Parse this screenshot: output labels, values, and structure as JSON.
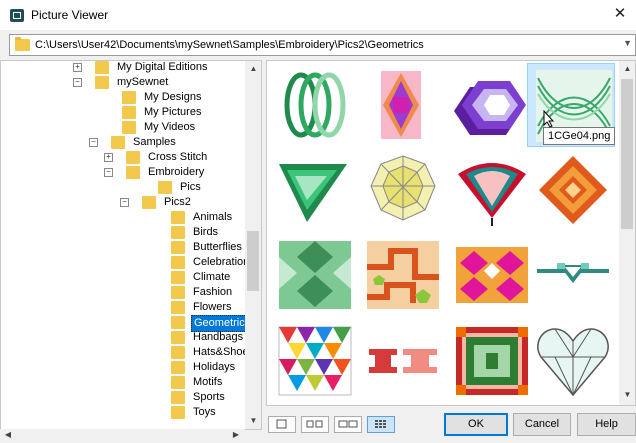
{
  "window": {
    "title": "Picture Viewer",
    "close_glyph": "✕"
  },
  "path": {
    "value": "C:\\Users\\User42\\Documents\\mySewnet\\Samples\\Embroidery\\Pics2\\Geometrics"
  },
  "tree": {
    "items": [
      {
        "label": "My Digital Editions",
        "expander": "+"
      },
      {
        "label": "mySewnet",
        "expander": "−"
      },
      {
        "label": "My Designs"
      },
      {
        "label": "My Pictures"
      },
      {
        "label": "My Videos"
      },
      {
        "label": "Samples",
        "expander": "−"
      },
      {
        "label": "Cross Stitch",
        "expander": "+"
      },
      {
        "label": "Embroidery",
        "expander": "−"
      },
      {
        "label": "Pics"
      },
      {
        "label": "Pics2",
        "expander": "−"
      },
      {
        "label": "Animals"
      },
      {
        "label": "Birds"
      },
      {
        "label": "Butterflies"
      },
      {
        "label": "Celebration"
      },
      {
        "label": "Climate"
      },
      {
        "label": "Fashion"
      },
      {
        "label": "Flowers"
      },
      {
        "label": "Geometrics",
        "selected": true
      },
      {
        "label": "Handbags"
      },
      {
        "label": "Hats&Shoes"
      },
      {
        "label": "Holidays"
      },
      {
        "label": "Motifs"
      },
      {
        "label": "Sports"
      },
      {
        "label": "Toys"
      }
    ]
  },
  "thumbnails": [
    {
      "icon": "green-rings-icon"
    },
    {
      "icon": "pink-diamond-rectangle-icon"
    },
    {
      "icon": "purple-hexagons-icon"
    },
    {
      "icon": "green-arcs-icon",
      "hovered": true
    },
    {
      "icon": "green-chevron-icon"
    },
    {
      "icon": "yellow-octagon-icon"
    },
    {
      "icon": "red-fan-icon"
    },
    {
      "icon": "orange-diamond-maze-icon"
    },
    {
      "icon": "green-cube-pattern-icon"
    },
    {
      "icon": "orange-zigzag-square-icon"
    },
    {
      "icon": "pink-magenta-diamonds-icon"
    },
    {
      "icon": "teal-arrow-motif-icon"
    },
    {
      "icon": "multicolor-triangles-icon"
    },
    {
      "icon": "red-key-pattern-icon"
    },
    {
      "icon": "red-green-frame-icon"
    },
    {
      "icon": "teal-heart-gem-icon"
    }
  ],
  "tooltip": {
    "text": "1CGe04.png"
  },
  "footer": {
    "ok_label": "OK",
    "cancel_label": "Cancel",
    "help_label": "Help"
  },
  "colors": {
    "selection": "#0078d7",
    "hover": "#cce8ff",
    "folder": "#f2c94c"
  }
}
